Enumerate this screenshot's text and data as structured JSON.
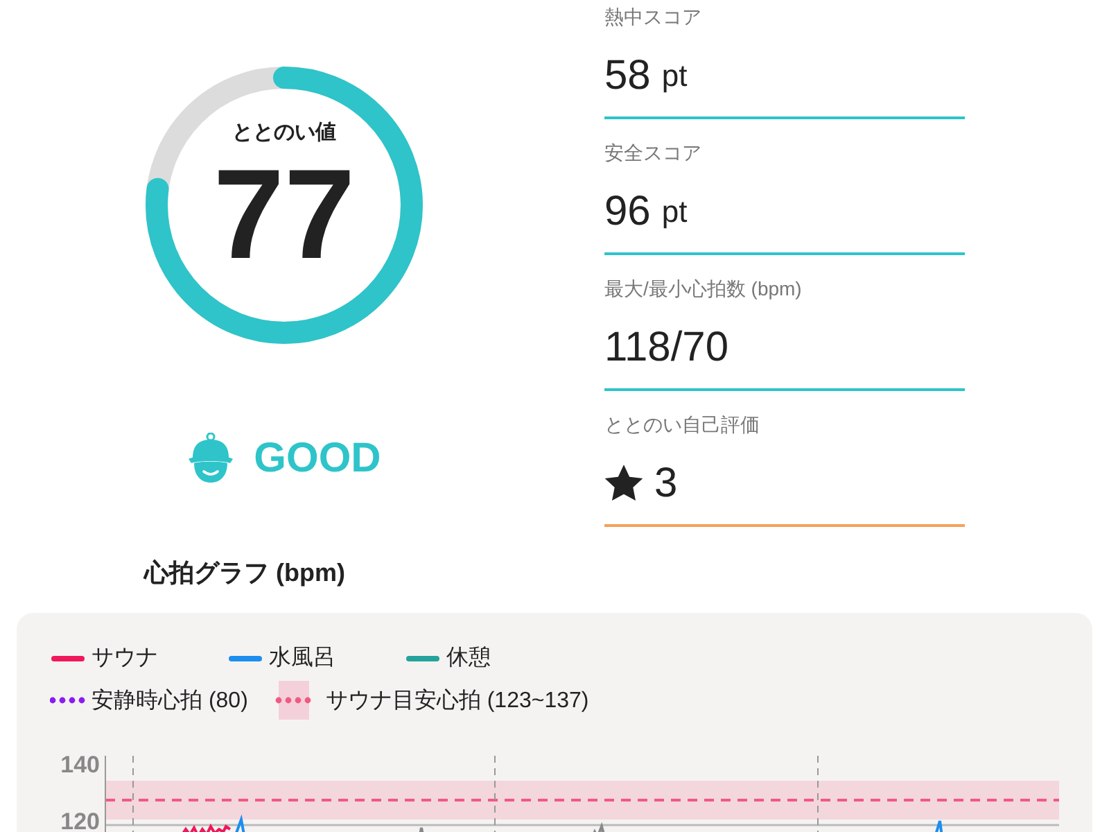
{
  "gauge": {
    "label": "ととのい値",
    "value": "77",
    "level": 0.77
  },
  "rating": {
    "text": "GOOD"
  },
  "metrics": [
    {
      "kind": "score",
      "label": "熱中スコア",
      "value": "58",
      "unit": "pt",
      "color": "#2ec4c9"
    },
    {
      "kind": "score",
      "label": "安全スコア",
      "value": "96",
      "unit": "pt",
      "color": "#2ec4c9"
    },
    {
      "kind": "plain",
      "label": "最大/最小心拍数 (bpm)",
      "value": "118/70",
      "color": "#2ec4c9"
    },
    {
      "kind": "rating",
      "label": "ととのい自己評価",
      "value": "3",
      "color": "#f3a259"
    }
  ],
  "heart_rate_chart": {
    "title": "心拍グラフ (bpm)",
    "legend": [
      {
        "kind": "line",
        "label": "サウナ",
        "color": "#f0185a"
      },
      {
        "kind": "line",
        "label": "水風呂",
        "color": "#1c8ef0"
      },
      {
        "kind": "line",
        "label": "休憩",
        "color": "#23a39c"
      },
      {
        "kind": "dotted",
        "label": "安静時心拍 (80)",
        "color": "#8a1cf0"
      },
      {
        "kind": "band",
        "label": "サウナ目安心拍 (123~137)",
        "color": "#f05a82"
      }
    ],
    "y_labels": [
      "140",
      "120"
    ]
  }
}
